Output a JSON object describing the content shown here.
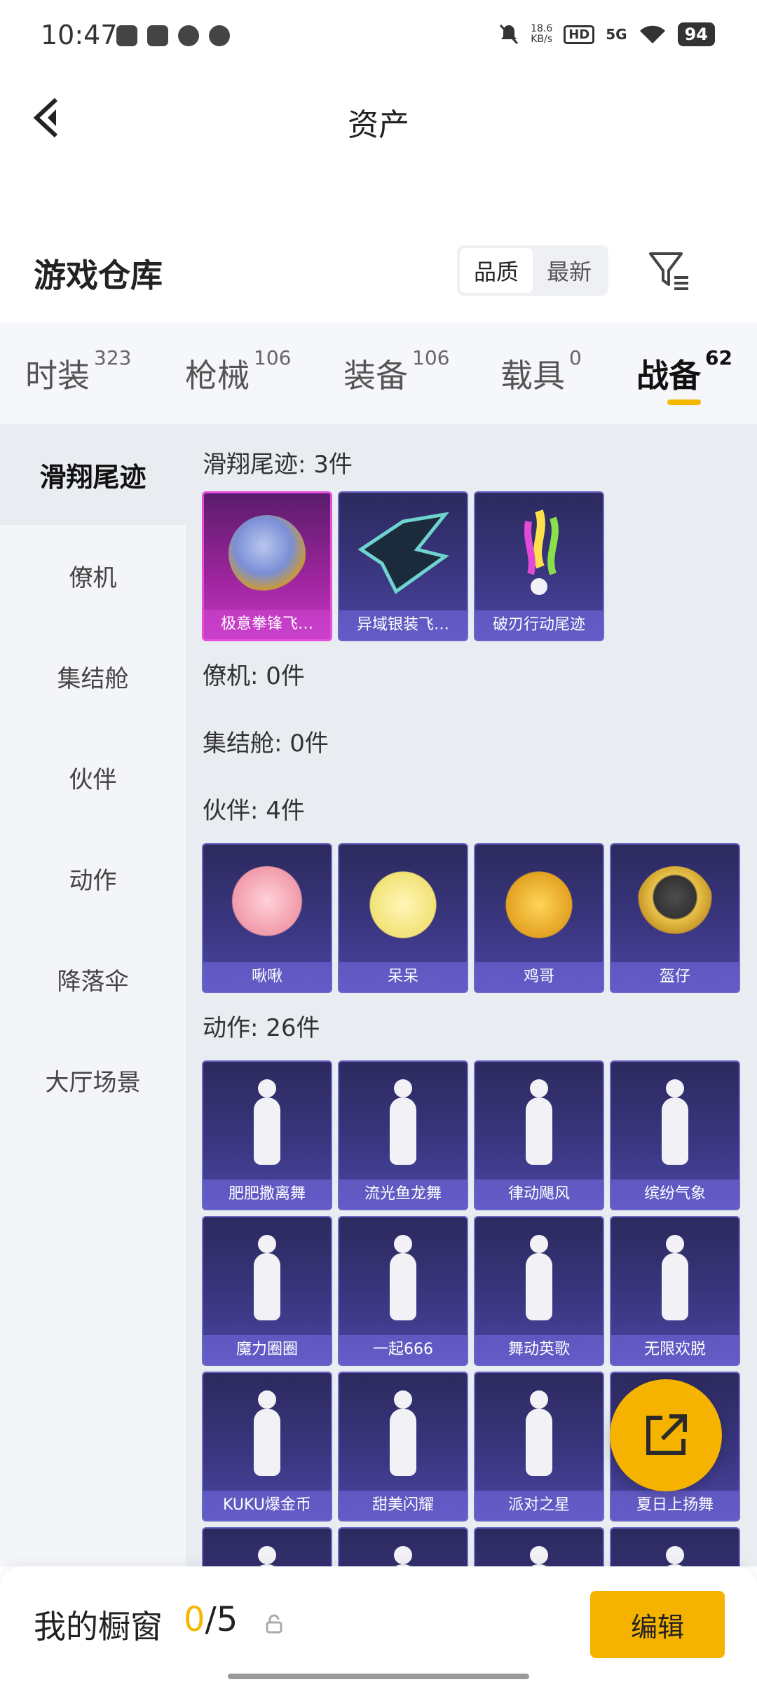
{
  "status_bar": {
    "time": "10:47",
    "net_speed_value": "18.6",
    "net_speed_unit": "KB/s",
    "hd": "HD",
    "network": "5G",
    "battery": "94"
  },
  "header": {
    "title": "资产"
  },
  "warehouse": {
    "title": "游戏仓库",
    "sort_options": [
      "品质",
      "最新"
    ],
    "sort_selected": "品质"
  },
  "tabs": [
    {
      "label": "时装",
      "count": "323"
    },
    {
      "label": "枪械",
      "count": "106"
    },
    {
      "label": "装备",
      "count": "106"
    },
    {
      "label": "载具",
      "count": "0"
    },
    {
      "label": "战备",
      "count": "62",
      "active": true
    }
  ],
  "sidebar": {
    "items": [
      "滑翔尾迹",
      "僚机",
      "集结舱",
      "伙伴",
      "动作",
      "降落伞",
      "大厅场景"
    ],
    "active": "滑翔尾迹"
  },
  "groups": {
    "trail": {
      "label": "滑翔尾迹: 3件",
      "items": [
        "极意拳锋飞…",
        "异域银装飞…",
        "破刃行动尾迹"
      ]
    },
    "wingman": {
      "label": "僚机: 0件"
    },
    "pod": {
      "label": "集结舱: 0件"
    },
    "partner": {
      "label": "伙伴: 4件",
      "items": [
        "啾啾",
        "呆呆",
        "鸡哥",
        "盔仔"
      ]
    },
    "emote": {
      "label": "动作: 26件",
      "items": [
        "肥肥撒离舞",
        "流光鱼龙舞",
        "律动飓风",
        "缤纷气象",
        "魔力圈圈",
        "一起666",
        "舞动英歌",
        "无限欢脱",
        "KUKU爆金币",
        "甜美闪耀",
        "派对之星",
        "夏日上扬舞"
      ]
    }
  },
  "bottom": {
    "showcase_label": "我的橱窗",
    "showcase_used": "0",
    "showcase_total": "/5",
    "edit_label": "编辑"
  },
  "colors": {
    "accent": "#f5b300",
    "card_bg": "#3a3680",
    "card_highlight": "#c13ac4"
  }
}
